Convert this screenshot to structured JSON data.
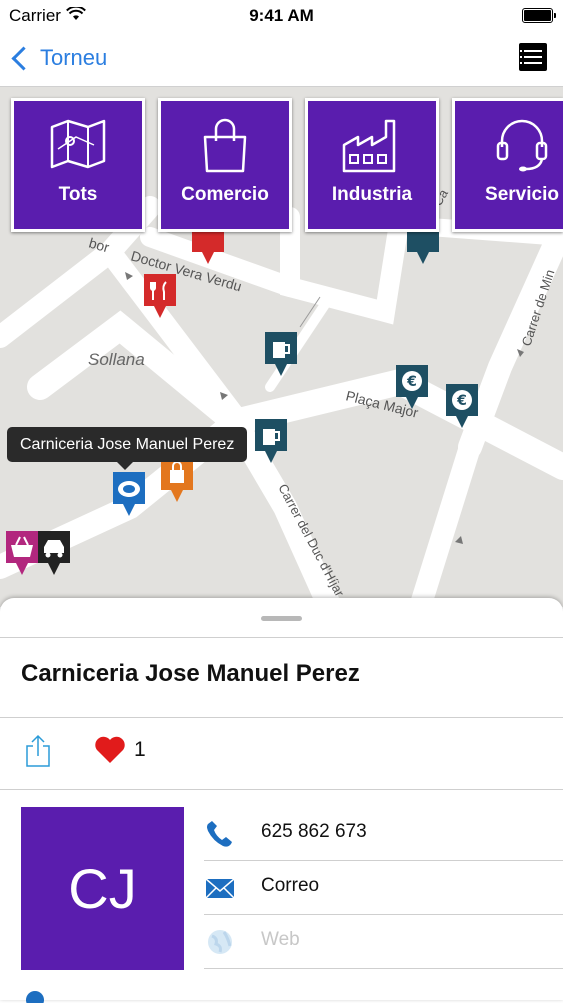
{
  "status_bar": {
    "carrier": "Carrier",
    "time": "9:41 AM"
  },
  "nav": {
    "back_label": "Torneu"
  },
  "categories": [
    {
      "label": "Tots",
      "icon": "map-icon"
    },
    {
      "label": "Comercio",
      "icon": "shopping-bag-icon"
    },
    {
      "label": "Industria",
      "icon": "factory-icon"
    },
    {
      "label": "Servicio",
      "icon": "headset-icon"
    }
  ],
  "map": {
    "labels": [
      "Doctor Vera Verdu",
      "Sollana",
      "Plaça Major",
      "Carrer del Duc d'Híjar",
      "Carrer de Min",
      "bor",
      "Ca"
    ],
    "markers": [
      {
        "type": "restaurant",
        "color": "#d42a2a"
      },
      {
        "type": "pub",
        "color": "#1e4f63"
      },
      {
        "type": "pub",
        "color": "#1e4f63"
      },
      {
        "type": "bank",
        "color": "#1e4f63"
      },
      {
        "type": "bank",
        "color": "#1e4f63"
      },
      {
        "type": "butcher",
        "color": "#1d6ec0"
      },
      {
        "type": "shop",
        "color": "#e3771e"
      },
      {
        "type": "basket",
        "color": "#b2277e"
      },
      {
        "type": "car",
        "color": "#222222"
      }
    ],
    "tooltip": "Carniceria Jose Manuel Perez"
  },
  "detail": {
    "title": "Carniceria Jose Manuel Perez",
    "likes": "1",
    "avatar_initials": "CJ",
    "phone": "625 862 673",
    "email_label": "Correo",
    "web_label": "Web"
  },
  "colors": {
    "accent": "#5a1dae",
    "link": "#2b7ee0"
  }
}
